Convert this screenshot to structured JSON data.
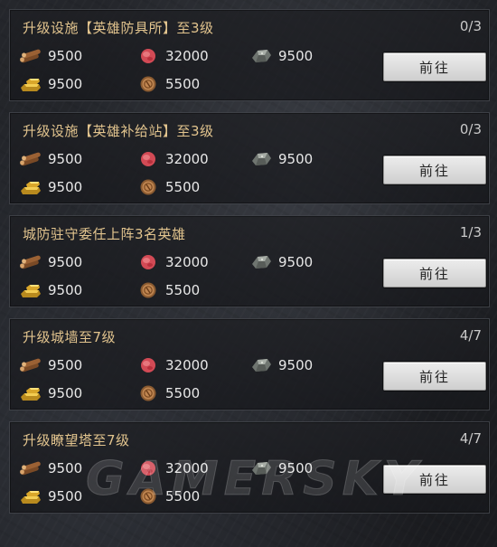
{
  "quests": [
    {
      "title": "升级设施【英雄防具所】至3级",
      "progress": "0/3",
      "wood": "9500",
      "meat": "32000",
      "stone": "9500",
      "gold": "9500",
      "coin": "5500",
      "button": "前往"
    },
    {
      "title": "升级设施【英雄补给站】至3级",
      "progress": "0/3",
      "wood": "9500",
      "meat": "32000",
      "stone": "9500",
      "gold": "9500",
      "coin": "5500",
      "button": "前往"
    },
    {
      "title": "城防驻守委任上阵3名英雄",
      "progress": "1/3",
      "wood": "9500",
      "meat": "32000",
      "stone": "9500",
      "gold": "9500",
      "coin": "5500",
      "button": "前往"
    },
    {
      "title": "升级城墙至7级",
      "progress": "4/7",
      "wood": "9500",
      "meat": "32000",
      "stone": "9500",
      "gold": "9500",
      "coin": "5500",
      "button": "前往"
    },
    {
      "title": "升级瞭望塔至7级",
      "progress": "4/7",
      "wood": "9500",
      "meat": "32000",
      "stone": "9500",
      "gold": "9500",
      "coin": "5500",
      "button": "前往"
    }
  ],
  "icons": {
    "wood": "wood-logs-icon",
    "meat": "meat-icon",
    "stone": "stone-ore-icon",
    "gold": "gold-bars-icon",
    "coin": "coin-icon"
  },
  "watermark": "GAMERSKY"
}
